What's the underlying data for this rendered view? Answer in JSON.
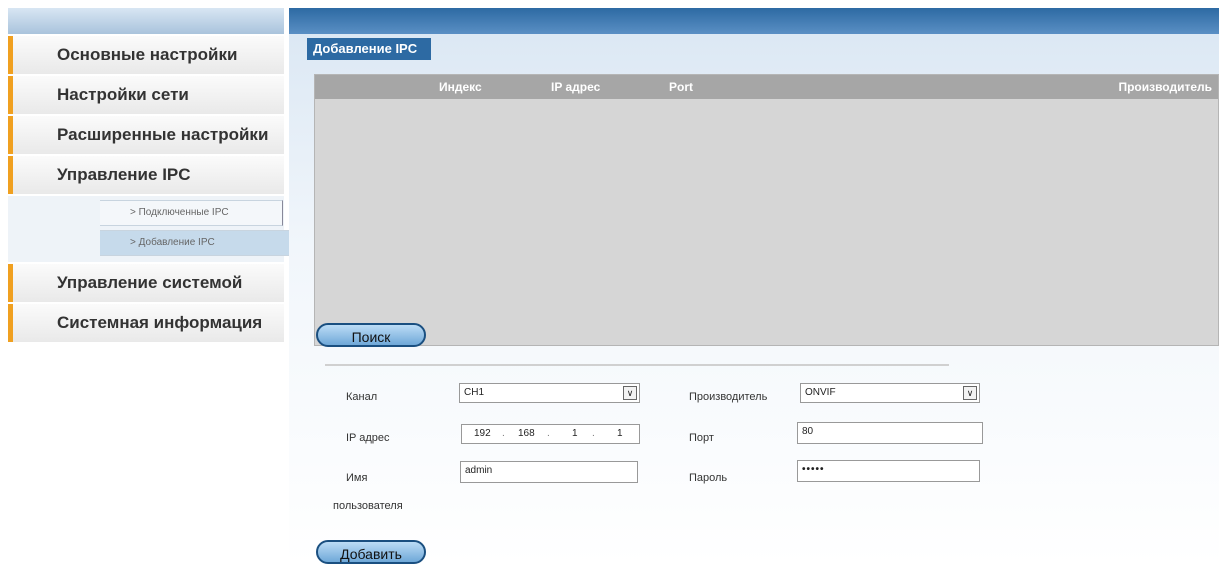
{
  "sidebar": {
    "items": [
      {
        "label": "Основные настройки"
      },
      {
        "label": "Настройки сети"
      },
      {
        "label": "Расширенные настройки"
      },
      {
        "label": "Управление IPC"
      },
      {
        "label": "Управление системой"
      },
      {
        "label": "Системная информация"
      }
    ],
    "subitems": [
      {
        "label": "> Подключенные IPC"
      },
      {
        "label": "> Добавление IPC"
      }
    ]
  },
  "main": {
    "tab": "Добавление IPC",
    "table": {
      "columns": [
        "Индекс",
        "IP адрес",
        "Port",
        "Производитель"
      ],
      "rows": []
    },
    "search_button": "Поиск",
    "form": {
      "channel_label": "Канал",
      "channel_value": "CH1",
      "vendor_label": "Производитель",
      "vendor_value": "ONVIF",
      "ip_label": "IP адрес",
      "ip": [
        "192",
        "168",
        "1",
        "1"
      ],
      "ip_dot": ".",
      "port_label": "Порт",
      "port_value": "80",
      "user_label_line1": "Имя",
      "user_label_line2": "пользователя",
      "user_value": "admin",
      "password_label": "Пароль",
      "password_value": "•••••",
      "select_arrow": "∨"
    },
    "add_button": "Добавить"
  },
  "colors": {
    "header_blue": "#2d6aa3",
    "accent_orange": "#f0a020",
    "grid_gray": "#d6d6d6"
  }
}
